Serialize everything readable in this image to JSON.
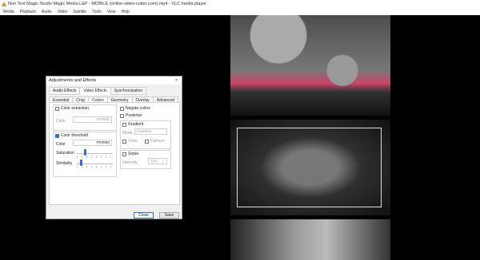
{
  "app": {
    "title": "Non Text Magic Studio Magic Media L&P - MOBILE (online-video-cutter.com).mp4 - VLC media player"
  },
  "menubar": [
    "Media",
    "Playback",
    "Audio",
    "Video",
    "Subtitle",
    "Tools",
    "View",
    "Help"
  ],
  "dialog": {
    "title": "Adjustments and Effects",
    "top_tabs": [
      "Audio Effects",
      "Video Effects",
      "Synchronization"
    ],
    "sub_tabs": [
      "Essential",
      "Crop",
      "Colors",
      "Geometry",
      "Overlay",
      "Advanced"
    ],
    "left": {
      "color_extraction": "Color extraction",
      "color_label": "Color",
      "color_value": "FF0000",
      "color_threshold": "Color threshold",
      "threshold_color_label": "Color",
      "threshold_color_value": "FF0000",
      "saturation": "Saturation",
      "similarity": "Similarity"
    },
    "right": {
      "negate": "Negate colors",
      "posterize": "Posterize",
      "gradient": "Gradient",
      "mode": "Mode",
      "mode_value": "Gradient",
      "color": "Color",
      "cartoon": "Cartoon",
      "sepia": "Sepia",
      "intensity": "Intensity",
      "intensity_value": "120"
    },
    "buttons": {
      "close": "Close",
      "save": "Save"
    }
  }
}
